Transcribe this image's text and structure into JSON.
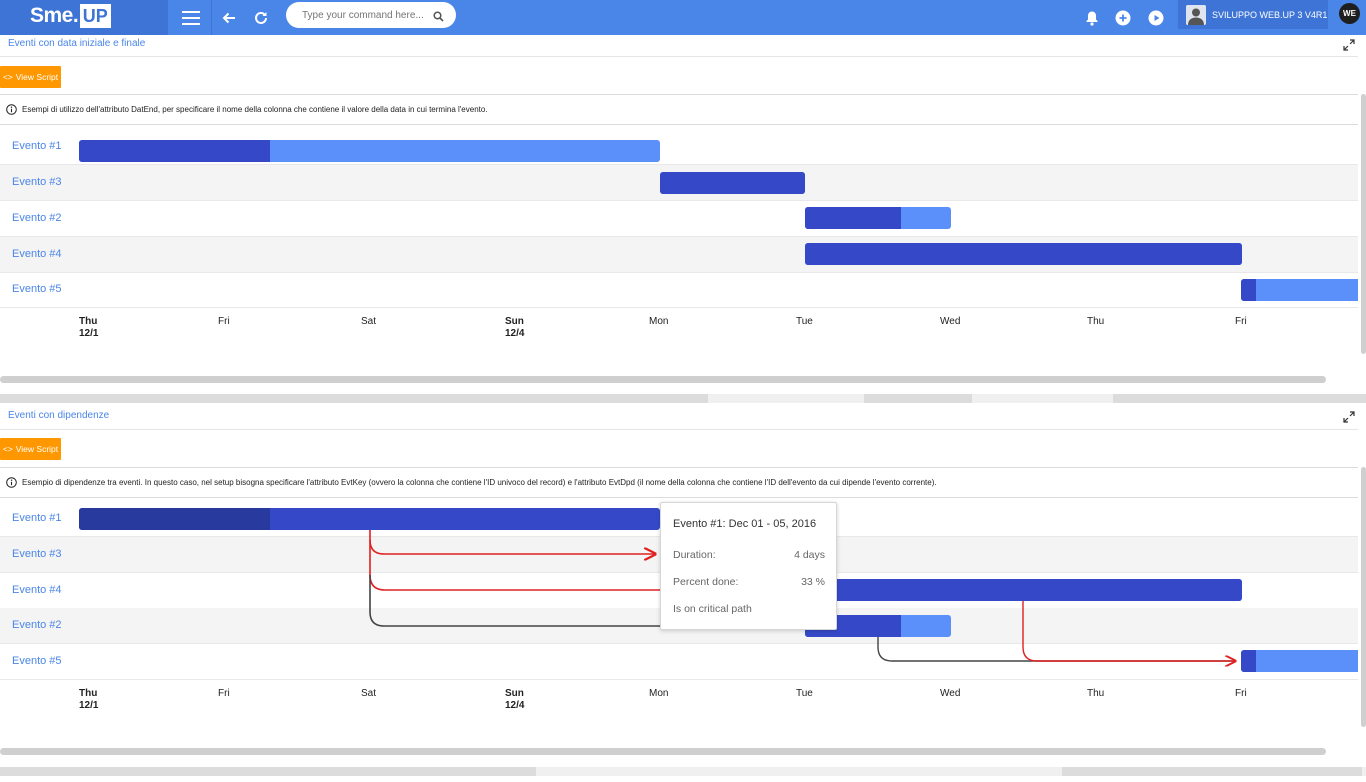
{
  "header": {
    "logo_main": "Sme",
    "logo_dot": ".",
    "logo_up": "UP",
    "command_placeholder": "Type your command here...",
    "user_name": "SVILUPPO WEB.UP 3 V4R1",
    "user_initials": "WE"
  },
  "section1": {
    "title": "Eventi con data iniziale e finale",
    "view_script_label": "View Script",
    "info": "Esempi di utilizzo dell'attributo DatEnd, per specificare il nome della colonna che contiene il valore della data in cui termina l'evento.",
    "rows": [
      {
        "label": "Evento #1"
      },
      {
        "label": "Evento #3"
      },
      {
        "label": "Evento #2"
      },
      {
        "label": "Evento #4"
      },
      {
        "label": "Evento #5"
      }
    ]
  },
  "section2": {
    "title": "Eventi con dipendenze",
    "view_script_label": "View Script",
    "info": "Esempio di dipendenze tra eventi. In questo caso, nel setup bisogna specificare l'attributo EvtKey (ovvero la colonna che contiene l'ID univoco del record) e l'attributo EvtDpd (il nome della colonna che contiene l'ID dell'evento da cui dipende l'evento corrente).",
    "rows": [
      {
        "label": "Evento #1"
      },
      {
        "label": "Evento #3"
      },
      {
        "label": "Evento #4"
      },
      {
        "label": "Evento #2"
      },
      {
        "label": "Evento #5"
      }
    ]
  },
  "timeline": {
    "ticks": [
      {
        "day": "Thu",
        "date": "12/1",
        "bold": true
      },
      {
        "day": "Fri",
        "date": "",
        "bold": false
      },
      {
        "day": "Sat",
        "date": "",
        "bold": false
      },
      {
        "day": "Sun",
        "date": "12/4",
        "bold": true
      },
      {
        "day": "Mon",
        "date": "",
        "bold": false
      },
      {
        "day": "Tue",
        "date": "",
        "bold": false
      },
      {
        "day": "Wed",
        "date": "",
        "bold": false
      },
      {
        "day": "Thu",
        "date": "",
        "bold": false
      },
      {
        "day": "Fri",
        "date": "",
        "bold": false
      }
    ]
  },
  "tooltip": {
    "title": "Evento #1: Dec 01 - 05, 2016",
    "duration_label": "Duration:",
    "duration_value": "4 days",
    "percent_label": "Percent done:",
    "percent_value": "33 %",
    "critical": "Is on critical path"
  },
  "colors": {
    "topbar": "#4a86e8",
    "bar_done": "#3549c8",
    "bar_todo": "#5b8ff9",
    "critical_link": "#e02020",
    "normal_link": "#444444",
    "view_script": "#ff9800"
  }
}
